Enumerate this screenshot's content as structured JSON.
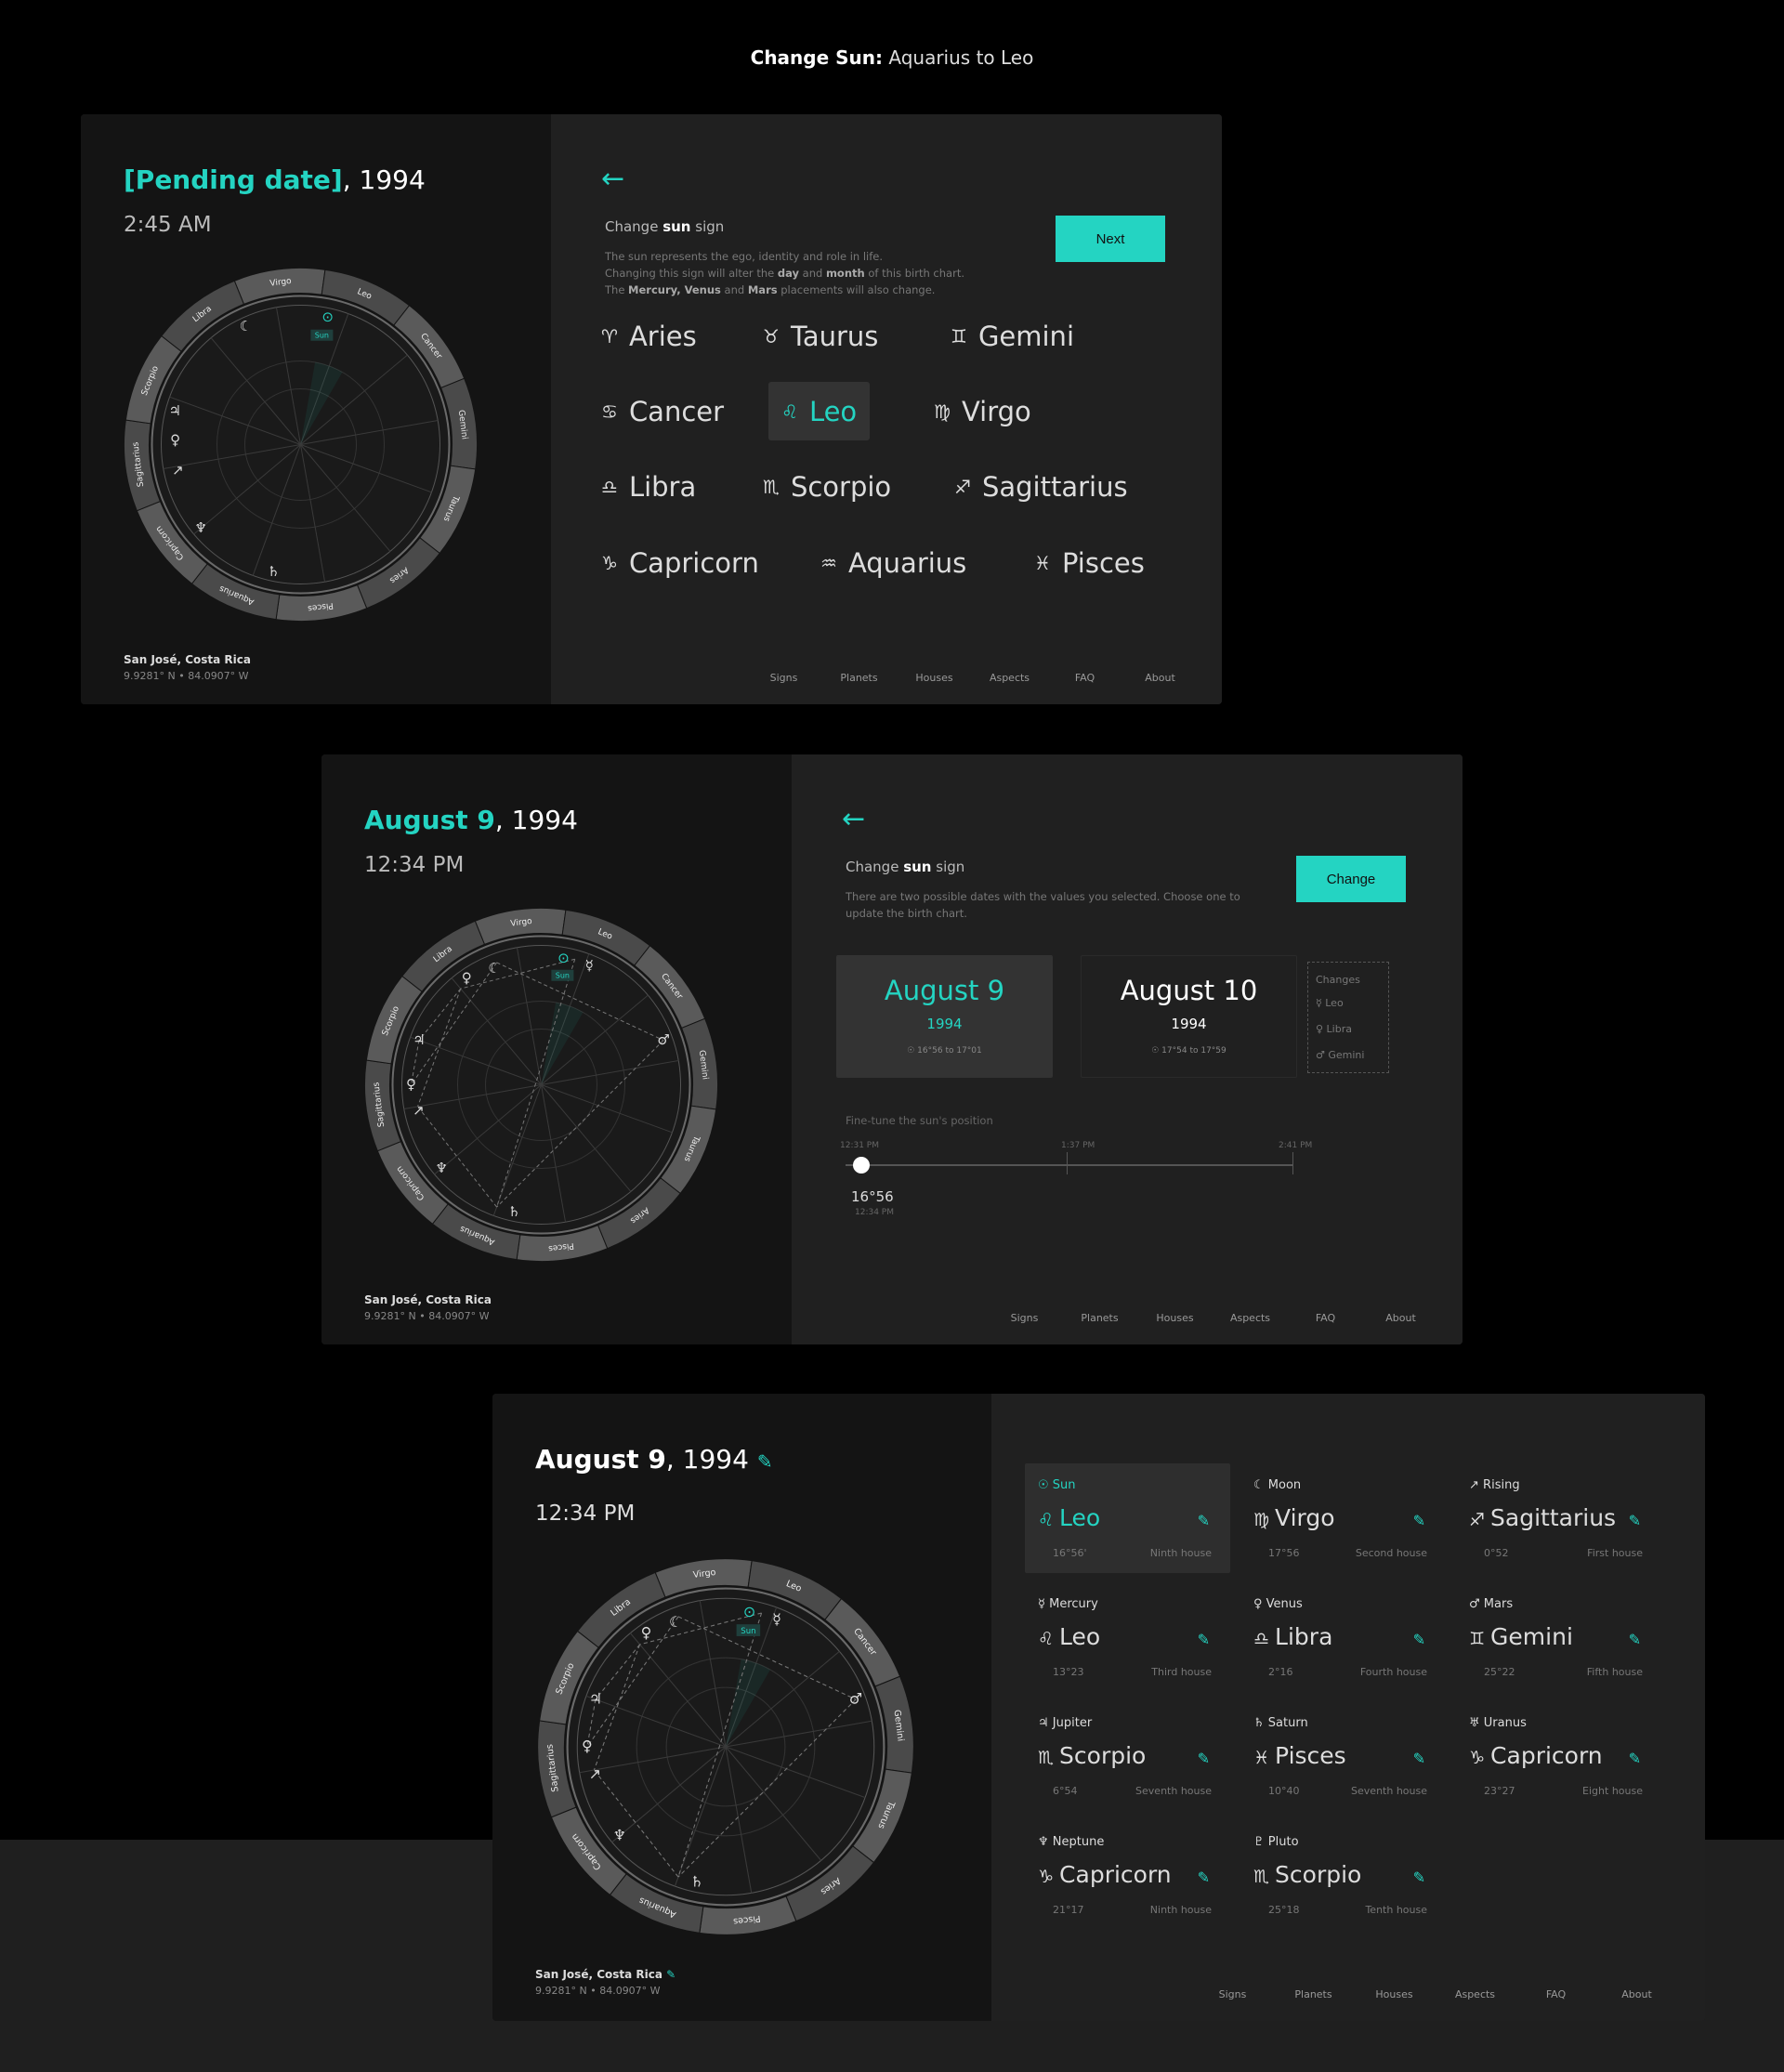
{
  "page_title": {
    "bold": "Change Sun:",
    "rest": " Aquarius to Leo"
  },
  "colors": {
    "accent": "#24d4c2",
    "bg": "#000000",
    "panel_left": "#141414",
    "panel_right": "#202020"
  },
  "nav": [
    "Signs",
    "Planets",
    "Houses",
    "Aspects",
    "FAQ",
    "About"
  ],
  "location": {
    "name": "San José, Costa Rica",
    "coords": "9.9281° N • 84.0907° W"
  },
  "chart_labels": {
    "signs": [
      "Virgo",
      "Leo",
      "Cancer",
      "Gemini",
      "Taurus",
      "Aries",
      "Pisces",
      "Aquarius",
      "Capricorn",
      "Sagittarius",
      "Scorpio",
      "Libra"
    ],
    "sun_tag": "Sun"
  },
  "panel1": {
    "date_hl": "[Pending date]",
    "date_rest": ", 1994",
    "time": "2:45 AM",
    "title_pre": "Change ",
    "title_bold": "sun",
    "title_post": " sign",
    "desc1": "The sun represents the ego, identity and role in life.",
    "desc2a": "Changing this sign will alter the ",
    "desc2b": "day",
    "desc2c": " and ",
    "desc2d": "month",
    "desc2e": " of this birth chart.",
    "desc3a": "The ",
    "desc3b": "Mercury, Venus",
    "desc3c": " and ",
    "desc3d": "Mars",
    "desc3e": " placements will also change.",
    "next": "Next",
    "signs": [
      {
        "g": "♈",
        "n": "Aries"
      },
      {
        "g": "♉",
        "n": "Taurus"
      },
      {
        "g": "♊",
        "n": "Gemini"
      },
      {
        "g": "♋",
        "n": "Cancer"
      },
      {
        "g": "♌",
        "n": "Leo"
      },
      {
        "g": "♍",
        "n": "Virgo"
      },
      {
        "g": "♎",
        "n": "Libra"
      },
      {
        "g": "♏",
        "n": "Scorpio"
      },
      {
        "g": "♐",
        "n": "Sagittarius"
      },
      {
        "g": "♑",
        "n": "Capricorn"
      },
      {
        "g": "♒",
        "n": "Aquarius"
      },
      {
        "g": "♓",
        "n": "Pisces"
      }
    ]
  },
  "panel2": {
    "date_hl": "August 9",
    "date_rest": ", 1994",
    "time": "12:34 PM",
    "title_pre": "Change ",
    "title_bold": "sun",
    "title_post": " sign",
    "desc": "There are two possible dates with the values you selected. Choose one to update the birth chart.",
    "change": "Change",
    "card1": {
      "title": "August 9",
      "year": "1994",
      "range": "☉ 16°56 to 17°01"
    },
    "card2": {
      "title": "August 10",
      "year": "1994",
      "range": "☉ 17°54 to 17°59"
    },
    "changes": {
      "title": "Changes",
      "items": [
        "☿ Leo",
        "♀ Libra",
        "♂ Gemini"
      ]
    },
    "slider_label": "Fine-tune the sun's position",
    "ticks": [
      "12:31 PM",
      "1:37 PM",
      "2:41 PM"
    ],
    "value": "16°56",
    "value_time": "12:34 PM"
  },
  "panel3": {
    "date_bold": "August 9",
    "date_rest": ", 1994",
    "time": "12:34 PM",
    "pen": "✎",
    "planets": [
      {
        "glyph": "☉",
        "name": "Sun",
        "sg": "♌",
        "sign": "Leo",
        "deg": "16°56'",
        "house": "Ninth house"
      },
      {
        "glyph": "☾",
        "name": "Moon",
        "sg": "♍",
        "sign": "Virgo",
        "deg": "17°56",
        "house": "Second house"
      },
      {
        "glyph": "↗",
        "name": "Rising",
        "sg": "♐",
        "sign": "Sagittarius",
        "deg": "0°52",
        "house": "First house"
      },
      {
        "glyph": "☿",
        "name": "Mercury",
        "sg": "♌",
        "sign": "Leo",
        "deg": "13°23",
        "house": "Third house"
      },
      {
        "glyph": "♀",
        "name": "Venus",
        "sg": "♎",
        "sign": "Libra",
        "deg": "2°16",
        "house": "Fourth house"
      },
      {
        "glyph": "♂",
        "name": "Mars",
        "sg": "♊",
        "sign": "Gemini",
        "deg": "25°22",
        "house": "Fifth house"
      },
      {
        "glyph": "♃",
        "name": "Jupiter",
        "sg": "♏",
        "sign": "Scorpio",
        "deg": "6°54",
        "house": "Seventh house"
      },
      {
        "glyph": "♄",
        "name": "Saturn",
        "sg": "♓",
        "sign": "Pisces",
        "deg": "10°40",
        "house": "Seventh house"
      },
      {
        "glyph": "♅",
        "name": "Uranus",
        "sg": "♑",
        "sign": "Capricorn",
        "deg": "23°27",
        "house": "Eight house"
      },
      {
        "glyph": "♆",
        "name": "Neptune",
        "sg": "♑",
        "sign": "Capricorn",
        "deg": "21°17",
        "house": "Ninth house"
      },
      {
        "glyph": "♇",
        "name": "Pluto",
        "sg": "♏",
        "sign": "Scorpio",
        "deg": "25°18",
        "house": "Tenth house"
      }
    ]
  }
}
